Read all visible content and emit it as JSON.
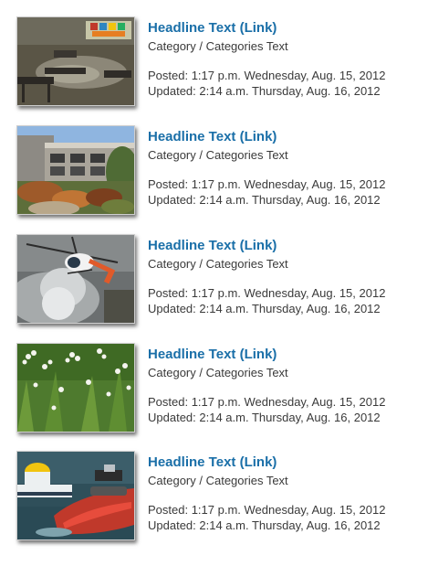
{
  "articles": [
    {
      "headline": "Headline Text (Link)",
      "category": "Category / Categories Text",
      "posted": "Posted: 1:17 p.m. Wednesday, Aug. 15, 2012",
      "updated": "Updated: 2:14 a.m. Thursday, Aug. 16, 2012",
      "image": "flooded-classroom"
    },
    {
      "headline": "Headline Text (Link)",
      "category": "Category / Categories Text",
      "posted": "Posted: 1:17 p.m. Wednesday, Aug. 15, 2012",
      "updated": "Updated: 2:14 a.m. Thursday, Aug. 16, 2012",
      "image": "school-building-garden"
    },
    {
      "headline": "Headline Text (Link)",
      "category": "Category / Categories Text",
      "posted": "Posted: 1:17 p.m. Wednesday, Aug. 15, 2012",
      "updated": "Updated: 2:14 a.m. Thursday, Aug. 16, 2012",
      "image": "firefighting-helicopter"
    },
    {
      "headline": "Headline Text (Link)",
      "category": "Category / Categories Text",
      "posted": "Posted: 1:17 p.m. Wednesday, Aug. 15, 2012",
      "updated": "Updated: 2:14 a.m. Thursday, Aug. 16, 2012",
      "image": "white-flowering-plant"
    },
    {
      "headline": "Headline Text (Link)",
      "category": "Category / Categories Text",
      "posted": "Posted: 1:17 p.m. Wednesday, Aug. 15, 2012",
      "updated": "Updated: 2:14 a.m. Thursday, Aug. 16, 2012",
      "image": "personal-watercraft"
    }
  ],
  "colors": {
    "headline_link": "#1a6fa8",
    "body_text": "#3a3a3a"
  }
}
